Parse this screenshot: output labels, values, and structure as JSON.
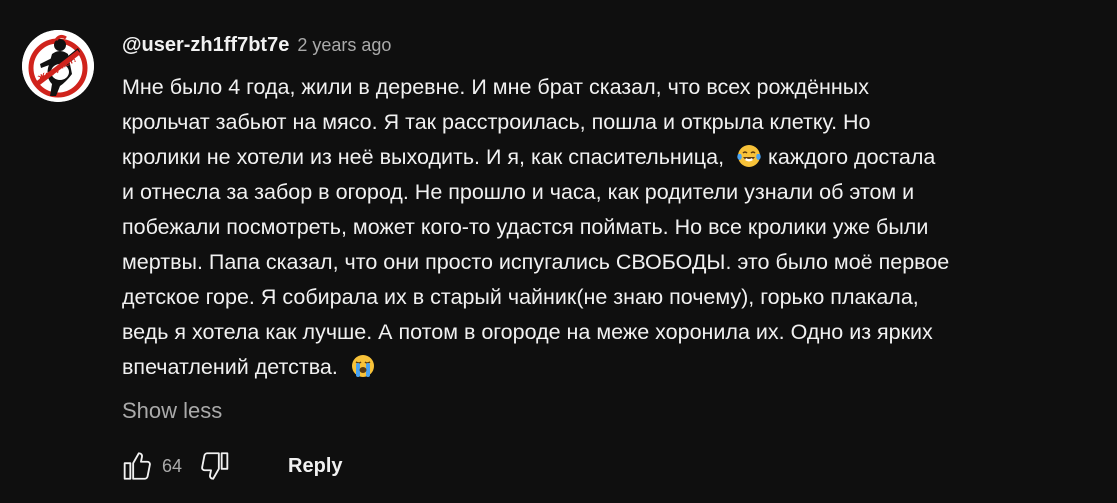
{
  "comment": {
    "author": "@user-zh1ff7bt7e",
    "timestamp": "2 years ago",
    "avatar_logo_text": "Жиру нет!",
    "text_lines": [
      [
        "Мне было 4 года, жили в деревне. И мне брат сказал, что всех рождённых"
      ],
      [
        "крольчат забьют на мясо. Я так расстроилась, пошла и открыла клетку. Но"
      ],
      [
        "кролики не хотели из неё выходить. И я, как спасительница, ",
        "каждого достала"
      ],
      [
        "и отнесла за забор в огород. Не прошло и часа, как родители узнали об этом и"
      ],
      [
        "побежали посмотреть, может кого-то удастся поймать. Но все кролики уже были"
      ],
      [
        "мертвы. Папа сказал, что они просто испугались СВОБОДЫ. это было моё первое"
      ],
      [
        "детское горе. Я собирала их в старый чайник(не знаю почему), горько плакала,"
      ],
      [
        "ведь я хотела как лучше. А потом в огороде на меже хоронила их. Одно из ярких"
      ],
      [
        "впечатлений детства. "
      ]
    ],
    "emojis": {
      "line3": "tears-of-joy-emoji",
      "line9": "loudly-crying-emoji"
    },
    "show_less_label": "Show less",
    "like_count": "64",
    "reply_label": "Reply"
  },
  "icons": {
    "like": "thumbs-up-icon",
    "dislike": "thumbs-down-icon"
  },
  "colors": {
    "background": "#0f0f0f",
    "primary_text": "#f1f1f1",
    "secondary_text": "#aaaaaa",
    "emoji_yellow": "#f7c239",
    "emoji_tear_blue": "#4aa3f0",
    "avatar_red": "#d0231c"
  }
}
